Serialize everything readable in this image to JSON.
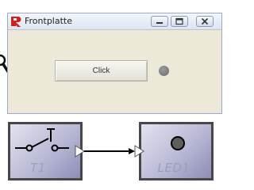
{
  "window": {
    "title": "Frontplatte",
    "icon": "red-app-icon",
    "controls": [
      "minimize-icon",
      "maximize-icon",
      "close-icon"
    ]
  },
  "panel": {
    "button_label": "Click",
    "led_state": "off",
    "led_color": "#7a7a7a"
  },
  "diagram": {
    "blocks": [
      {
        "label": "T1",
        "icon": "push-button-switch-icon"
      },
      {
        "label": "LED1",
        "icon": "led-icon"
      }
    ],
    "connection": {
      "from": "T1",
      "to": "LED1"
    }
  },
  "colors": {
    "block_fill": "#b9b9d6",
    "block_border": "#474747",
    "window_bg": "#ece9d8",
    "app_icon": "#d21f1f"
  }
}
